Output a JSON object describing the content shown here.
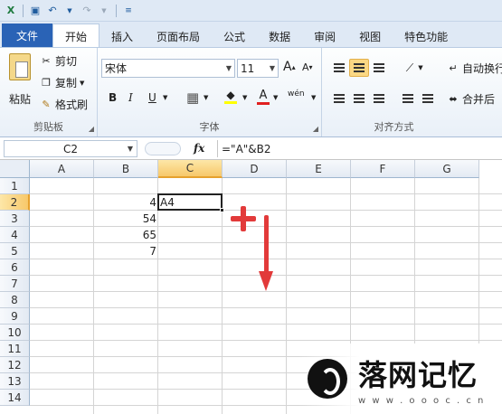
{
  "quick_access": {
    "icons": [
      "excel-icon",
      "save-icon",
      "undo-icon",
      "redo-icon",
      "customize-icon"
    ]
  },
  "tabs": [
    {
      "label": "文件",
      "kind": "file"
    },
    {
      "label": "开始",
      "kind": "active"
    },
    {
      "label": "插入"
    },
    {
      "label": "页面布局"
    },
    {
      "label": "公式"
    },
    {
      "label": "数据"
    },
    {
      "label": "审阅"
    },
    {
      "label": "视图"
    },
    {
      "label": "特色功能"
    }
  ],
  "ribbon": {
    "clipboard": {
      "paste": "粘贴",
      "cut": "剪切",
      "copy": "复制",
      "format_painter": "格式刷",
      "group_label": "剪贴板"
    },
    "font": {
      "font_name": "宋体",
      "font_size": "11",
      "grow": "A",
      "shrink": "A",
      "bold": "B",
      "italic": "I",
      "underline": "U",
      "font_color": "A",
      "phonetic": "wén",
      "group_label": "字体"
    },
    "alignment": {
      "wrap_text": "自动换行",
      "merge_center": "合并后",
      "group_label": "对齐方式"
    }
  },
  "formula_bar": {
    "name_box": "C2",
    "fx": "fx",
    "formula": "=\"A\"&B2"
  },
  "sheet": {
    "columns": [
      "A",
      "B",
      "C",
      "D",
      "E",
      "F",
      "G"
    ],
    "rows": [
      "1",
      "2",
      "3",
      "4",
      "5",
      "6",
      "7",
      "8",
      "9",
      "10",
      "11",
      "12",
      "13",
      "14"
    ],
    "selected_column": "C",
    "selected_row": "2",
    "cells": {
      "B2": "4",
      "B3": "54",
      "B4": "65",
      "B5": "7",
      "C2": "A4"
    }
  },
  "watermark": {
    "title": "落网记忆",
    "url": "w w w . o o o c . c n"
  },
  "colors": {
    "file_tab": "#2a63b6",
    "selection_header": "#f7c86a",
    "annotation_red": "#e23a3a"
  }
}
